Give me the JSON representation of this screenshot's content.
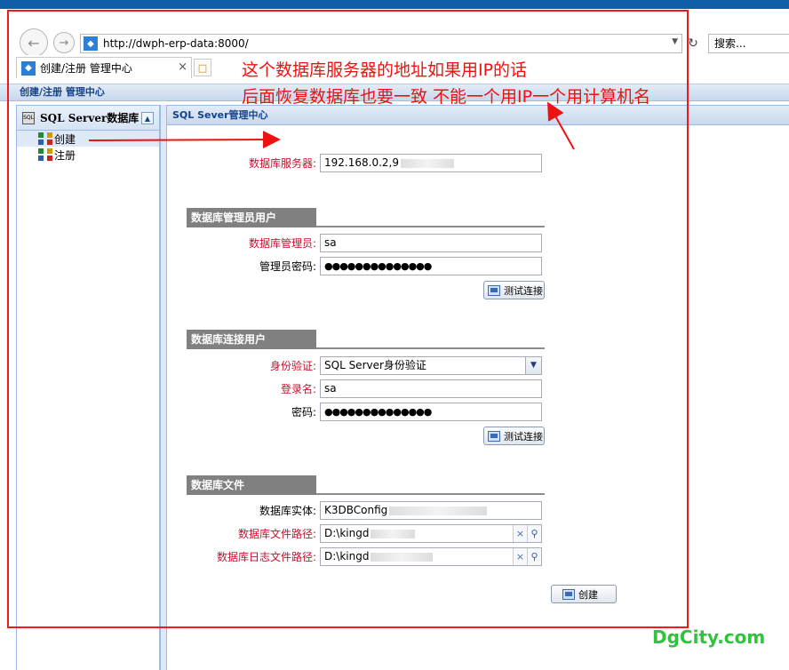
{
  "browser": {
    "url": "http://dwph-erp-data:8000/",
    "search_placeholder": "搜索...",
    "tab_title": "创建/注册 管理中心"
  },
  "page": {
    "header": "创建/注册 管理中心"
  },
  "sidebar": {
    "title": "SQL Server数据库",
    "items": [
      {
        "label": "创建"
      },
      {
        "label": "注册"
      }
    ]
  },
  "main": {
    "header": "SQL Sever管理中心",
    "db_server": {
      "label": "数据库服务器:",
      "value": "192.168.0.2,9"
    },
    "admin_section": {
      "title": "数据库管理员用户",
      "admin_label": "数据库管理员:",
      "admin_value": "sa",
      "pwd_label": "管理员密码:",
      "pwd_value": "●●●●●●●●●●●●●●",
      "test_button": "测试连接"
    },
    "conn_section": {
      "title": "数据库连接用户",
      "auth_label": "身份验证:",
      "auth_value": "SQL Server身份验证",
      "login_label": "登录名:",
      "login_value": "sa",
      "pwd_label": "密码:",
      "pwd_value": "●●●●●●●●●●●●●●",
      "test_button": "测试连接"
    },
    "file_section": {
      "title": "数据库文件",
      "entity_label": "数据库实体:",
      "entity_value": "K3DBConfig",
      "file_path_label": "数据库文件路径:",
      "file_path_value": "D:\\kingd",
      "log_path_label": "数据库日志文件路径:",
      "log_path_value": "D:\\kingd"
    },
    "create_button": "创建"
  },
  "annotations": {
    "note_line1": "这个数据库服务器的地址如果用IP的话",
    "note_line2": "后面恢复数据库也要一致   不能一个用IP一个用计算机名",
    "watermark": "DgCity.com",
    "color": "#ee1111"
  }
}
